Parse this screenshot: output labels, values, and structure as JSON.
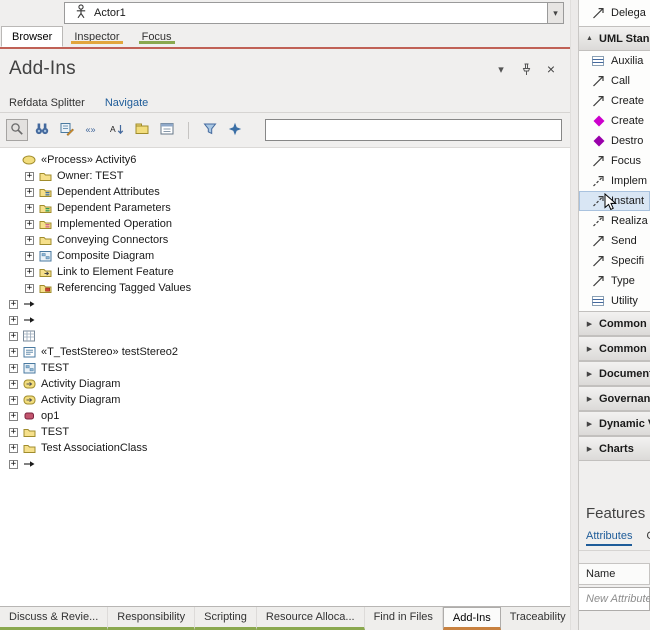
{
  "topbar": {
    "selected_element": "Actor1",
    "dropdown_glyph": "▾"
  },
  "main_tabs": [
    {
      "label": "Browser",
      "active": true,
      "underline": ""
    },
    {
      "label": "Inspector",
      "active": false,
      "underline": "#e2a53c"
    },
    {
      "label": "Focus",
      "active": false,
      "underline": "#8aa84e"
    }
  ],
  "addins": {
    "title": "Add-Ins",
    "window_icons": {
      "menu_glyph": "▾",
      "close_glyph": "×"
    },
    "sub_tabs": [
      {
        "label": "Refdata Splitter",
        "active": false
      },
      {
        "label": "Navigate",
        "active": true
      }
    ],
    "toolbar": {
      "search_value": "",
      "icons": [
        "zoom",
        "binoculars",
        "diagram-usage",
        "stereotype",
        "sort",
        "package",
        "calendar",
        "separator",
        "filter",
        "compass"
      ]
    },
    "tree": [
      {
        "depth": 0,
        "expander": "",
        "icon": "process",
        "label": "«Process» Activity6"
      },
      {
        "depth": 1,
        "expander": "+",
        "icon": "folder",
        "label": "Owner: TEST"
      },
      {
        "depth": 1,
        "expander": "+",
        "icon": "folder-attributes",
        "label": "Dependent Attributes"
      },
      {
        "depth": 1,
        "expander": "+",
        "icon": "folder-parameters",
        "label": "Dependent Parameters"
      },
      {
        "depth": 1,
        "expander": "+",
        "icon": "folder-operations",
        "label": "Implemented Operation"
      },
      {
        "depth": 1,
        "expander": "+",
        "icon": "folder",
        "label": "Conveying Connectors"
      },
      {
        "depth": 1,
        "expander": "+",
        "icon": "diagram",
        "label": "Composite Diagram"
      },
      {
        "depth": 1,
        "expander": "+",
        "icon": "folder-link",
        "label": "Link to Element Feature"
      },
      {
        "depth": 1,
        "expander": "+",
        "icon": "folder-tags",
        "label": "Referencing Tagged Values"
      },
      {
        "depth": 0,
        "expander": "+",
        "icon": "arrow",
        "label": ""
      },
      {
        "depth": 0,
        "expander": "+",
        "icon": "arrow",
        "label": ""
      },
      {
        "depth": 0,
        "expander": "+",
        "icon": "grid",
        "label": ""
      },
      {
        "depth": 0,
        "expander": "+",
        "icon": "stereotype-element",
        "label": "«T_TestStereo» testStereo2"
      },
      {
        "depth": 0,
        "expander": "+",
        "icon": "diagram",
        "label": "TEST"
      },
      {
        "depth": 0,
        "expander": "+",
        "icon": "activity-diagram",
        "label": "Activity Diagram"
      },
      {
        "depth": 0,
        "expander": "+",
        "icon": "activity-diagram",
        "label": "Activity Diagram"
      },
      {
        "depth": 0,
        "expander": "+",
        "icon": "operation",
        "label": "op1"
      },
      {
        "depth": 0,
        "expander": "+",
        "icon": "folder",
        "label": "TEST"
      },
      {
        "depth": 0,
        "expander": "+",
        "icon": "folder",
        "label": "Test AssociationClass"
      },
      {
        "depth": 0,
        "expander": "+",
        "icon": "arrow",
        "label": ""
      }
    ]
  },
  "toolbox": {
    "expanded_glyph": "▲",
    "collapsed_glyph": "▶",
    "top_item": {
      "label": "Delega",
      "icon": "connector-solid"
    },
    "groups": [
      {
        "label": "UML Stand",
        "expanded": true,
        "items": [
          {
            "label": "Auxilia",
            "icon": "stripes"
          },
          {
            "label": "Call",
            "icon": "connector-solid"
          },
          {
            "label": "Create",
            "icon": "connector-solid"
          },
          {
            "label": "Create",
            "icon": "diamond",
            "color": "#cc00cc"
          },
          {
            "label": "Destro",
            "icon": "diamond",
            "color": "#9900aa"
          },
          {
            "label": "Focus",
            "icon": "connector-solid"
          },
          {
            "label": "Implem",
            "icon": "connector-dashed"
          },
          {
            "label": "Instant",
            "icon": "connector-dashed",
            "highlighted": true,
            "cursor": true
          },
          {
            "label": "Realiza",
            "icon": "connector-dashed"
          },
          {
            "label": "Send",
            "icon": "connector-solid"
          },
          {
            "label": "Specifi",
            "icon": "connector-solid"
          },
          {
            "label": "Type",
            "icon": "connector-solid"
          },
          {
            "label": "Utility",
            "icon": "stripes"
          }
        ]
      },
      {
        "label": "Common E",
        "expanded": false,
        "items": []
      },
      {
        "label": "Common R",
        "expanded": false,
        "items": []
      },
      {
        "label": "Documents",
        "expanded": false,
        "items": []
      },
      {
        "label": "Governanc",
        "expanded": false,
        "items": []
      },
      {
        "label": "Dynamic V",
        "expanded": false,
        "items": []
      },
      {
        "label": "Charts",
        "expanded": false,
        "items": []
      }
    ]
  },
  "features": {
    "title": "Features",
    "tabs": [
      {
        "label": "Attributes",
        "active": true
      },
      {
        "label": "O",
        "active": false
      }
    ],
    "column_header": "Name",
    "new_item_placeholder": "New Attribute..."
  },
  "bottom_tabs": [
    {
      "label": "Discuss & Revie...",
      "underline": "#8aa84e",
      "active": false
    },
    {
      "label": "Responsibility",
      "underline": "#8aa84e",
      "active": false
    },
    {
      "label": "Scripting",
      "underline": "#8aa84e",
      "active": false
    },
    {
      "label": "Resource Alloca...",
      "underline": "#8aa84e",
      "active": false
    },
    {
      "label": "Find in Files",
      "underline": "",
      "active": false
    },
    {
      "label": "Add-Ins",
      "underline": "#c8813f",
      "active": true
    },
    {
      "label": "Traceability",
      "underline": "",
      "active": false
    }
  ]
}
